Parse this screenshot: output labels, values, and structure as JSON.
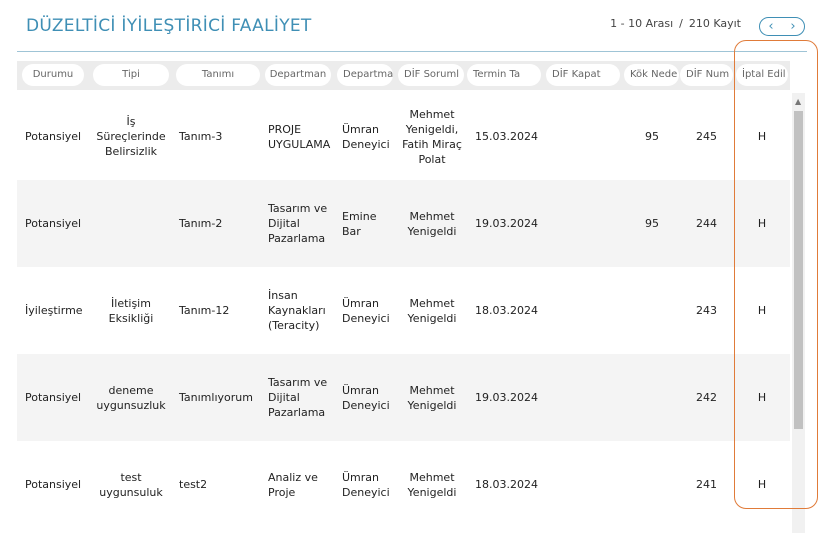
{
  "header": {
    "title": "DÜZELTİCİ İYİLEŞTİRİCİ FAALİYET",
    "range": "1 - 10 Arası",
    "separator": "/",
    "total": "210 Kayıt",
    "prev": "‹",
    "next": "›"
  },
  "columns": [
    "Durumu",
    "Tipi",
    "Tanımı",
    "Departman",
    "Departmaı",
    "DİF Soruml",
    "Termin Ta",
    "DİF Kapat",
    "Kök Nede",
    "DİF Num",
    "İptal Edil"
  ],
  "rows": [
    {
      "durumu": "Potansiyel",
      "tipi": "İş Süreçlerinde Belirsizlik",
      "tanimi": "Tanım-3",
      "departman": "PROJE UYGULAMA",
      "departman2": "Ümran Deneyici",
      "sorumlu": "Mehmet Yenigeldi, Fatih Miraç Polat",
      "termin": "15.03.2024",
      "kapat": "",
      "kok": "95",
      "num": "245",
      "iptal": "H"
    },
    {
      "durumu": "Potansiyel",
      "tipi": "",
      "tanimi": "Tanım-2",
      "departman": "Tasarım ve Dijital Pazarlama",
      "departman2": "Emine Bar",
      "sorumlu": "Mehmet Yenigeldi",
      "termin": "19.03.2024",
      "kapat": "",
      "kok": "95",
      "num": "244",
      "iptal": "H"
    },
    {
      "durumu": "İyileştirme",
      "tipi": "İletişim Eksikliği",
      "tanimi": "Tanım-12",
      "departman": "İnsan Kaynakları (Teracity)",
      "departman2": "Ümran Deneyici",
      "sorumlu": "Mehmet Yenigeldi",
      "termin": "18.03.2024",
      "kapat": "",
      "kok": "",
      "num": "243",
      "iptal": "H"
    },
    {
      "durumu": "Potansiyel",
      "tipi": "deneme uygunsuzluk",
      "tanimi": "Tanımlıyorum",
      "departman": "Tasarım ve Dijital Pazarlama",
      "departman2": "Ümran Deneyici",
      "sorumlu": "Mehmet Yenigeldi",
      "termin": "19.03.2024",
      "kapat": "",
      "kok": "",
      "num": "242",
      "iptal": "H"
    },
    {
      "durumu": "Potansiyel",
      "tipi": "test uygunsuluk",
      "tanimi": "test2",
      "departman": "Analiz ve Proje",
      "departman2": "Ümran Deneyici",
      "sorumlu": "Mehmet Yenigeldi",
      "termin": "18.03.2024",
      "kapat": "",
      "kok": "",
      "num": "241",
      "iptal": "H"
    }
  ],
  "scrollbar": {
    "up_arrow": "▲"
  },
  "colors": {
    "accent": "#3f8fb5",
    "highlight": "#e07b39",
    "header_bg": "#ececec",
    "row_shade": "#f4f4f4"
  }
}
